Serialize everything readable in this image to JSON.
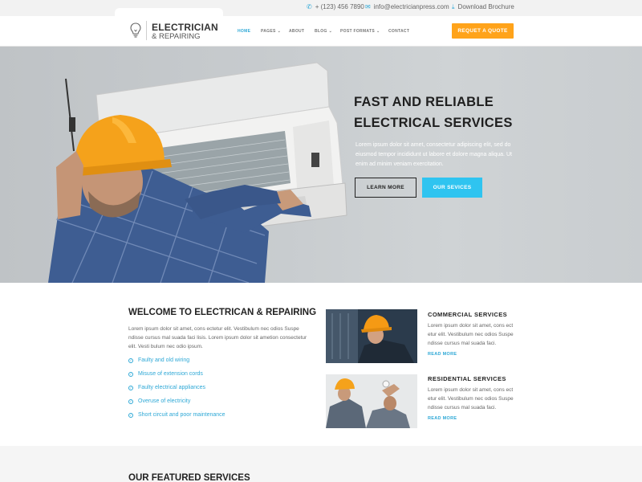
{
  "topbar": {
    "phone": "+ (123) 456 7890",
    "email": "info@electricianpress.com",
    "brochure": "Download Brochure"
  },
  "brand": {
    "title": "ELECTRICIAN",
    "subtitle": "& REPAIRING"
  },
  "nav": {
    "items": [
      {
        "label": "HOME",
        "has_dropdown": false,
        "active": true
      },
      {
        "label": "PAGES",
        "has_dropdown": true,
        "active": false
      },
      {
        "label": "ABOUT",
        "has_dropdown": false,
        "active": false
      },
      {
        "label": "BLOG",
        "has_dropdown": true,
        "active": false
      },
      {
        "label": "POST FORMATS",
        "has_dropdown": true,
        "active": false
      },
      {
        "label": "CONTACT",
        "has_dropdown": false,
        "active": false
      }
    ],
    "quote_button": "REQUET A QUOTE"
  },
  "hero": {
    "title_line1": "FAST AND RELIABLE",
    "title_line2": "ELECTRICAL SERVICES",
    "text": "Lorem ipsum dolor sit amet, consectetur adipiscing elit, sed do eiusmod tempor incididunt ut labore et dolore magna aliqua. Ut enim ad minim veniam exercitation.",
    "learn_more": "LEARN MORE",
    "our_services": "OUR SEVICES"
  },
  "welcome": {
    "title": "WELCOME TO ELECTRICAN & REPAIRING",
    "text": "Lorem ipsum dolor sit amet, cons ectetur elit. Vestibulum nec odios Suspe ndisse cursus mal suada faci lisis. Lorem ipsum dolor sit ametion consectetur elit. Vesti bulum nec odio ipsum.",
    "features": [
      "Faulty and old wiring",
      "Misuse of extension cords",
      "Faulty electrical appliances",
      "Overuse of electricity",
      "Short circuit and poor maintenance"
    ]
  },
  "services": [
    {
      "title": "COMMERCIAL SERVICES",
      "text": "Lorem ipsum dolor sit amet, cons ect etur elit. Vestibulum nec odios Suspe ndisse cursus mal suada faci.",
      "more": "READ MORE"
    },
    {
      "title": "RESIDENTIAL SERVICES",
      "text": "Lorem ipsum dolor sit amet, cons ect etur elit. Vestibulum nec odios Suspe ndisse cursus mal suada faci.",
      "more": "READ MORE"
    }
  ],
  "featured": {
    "title": "OUR FEATURED SERVICES"
  },
  "colors": {
    "accent": "#2ea8d6",
    "cta": "#ffa31a",
    "service_button": "#2fc4f0"
  },
  "icons": {
    "phone": "phone-icon",
    "email": "email-icon",
    "download": "download-icon",
    "logo": "lightbulb-icon",
    "check": "check-circle-icon"
  }
}
